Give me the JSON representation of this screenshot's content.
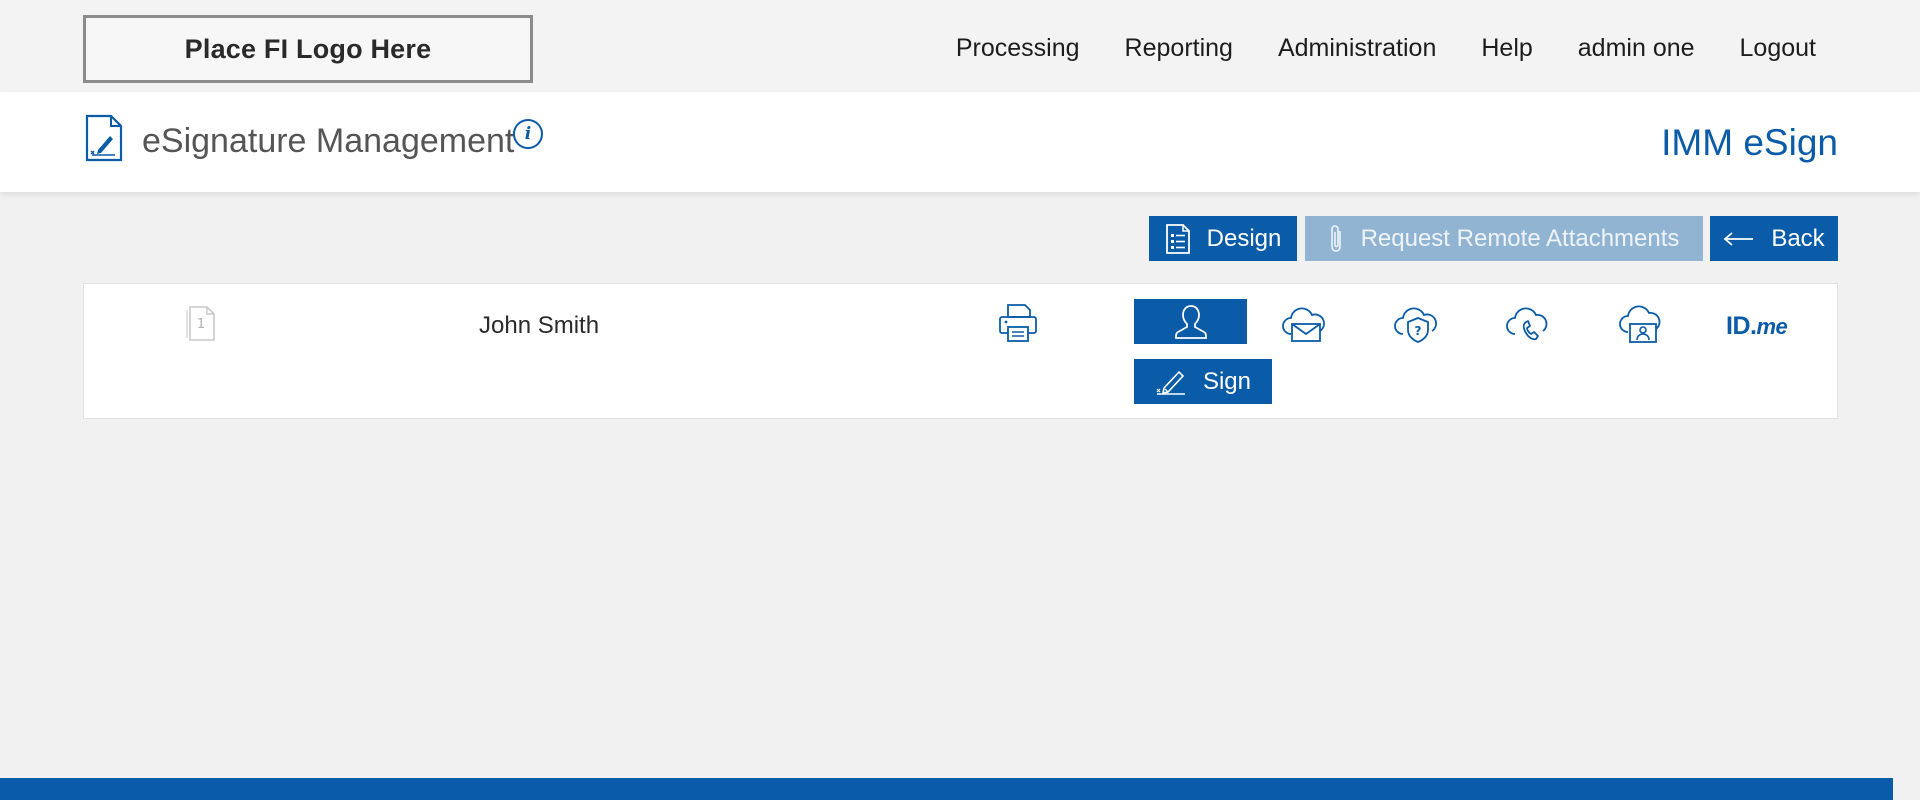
{
  "header": {
    "logo_text": "Place FI Logo Here",
    "nav": [
      {
        "label": "Processing"
      },
      {
        "label": "Reporting"
      },
      {
        "label": "Administration"
      },
      {
        "label": "Help"
      },
      {
        "label": "admin one"
      },
      {
        "label": "Logout"
      }
    ]
  },
  "titlebar": {
    "title": "eSignature Management",
    "info_glyph": "i",
    "brand": "IMM eSign"
  },
  "actions": {
    "design_label": "Design",
    "remote_label": "Request Remote Attachments",
    "back_label": "Back"
  },
  "signer": {
    "page_number": "1",
    "name": "John Smith",
    "sign_label": "Sign",
    "auth_methods": [
      {
        "icon": "person-icon",
        "active": true
      },
      {
        "icon": "cloud-mail-icon",
        "active": false
      },
      {
        "icon": "cloud-shield-question-icon",
        "active": false
      },
      {
        "icon": "cloud-phone-icon",
        "active": false
      },
      {
        "icon": "cloud-id-card-icon",
        "active": false
      }
    ],
    "idme_text": {
      "id": "ID",
      "dot": ".",
      "me": "me"
    }
  },
  "colors": {
    "primary": "#0a5ca8",
    "disabled": "#92b4d3",
    "background": "#f1f1f1"
  }
}
